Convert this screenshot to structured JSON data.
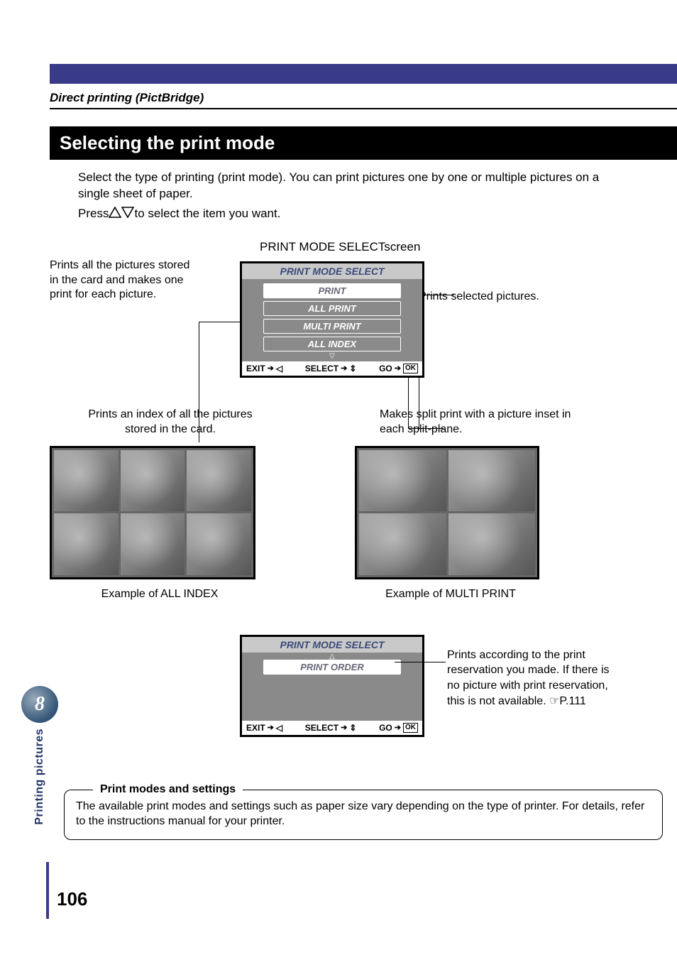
{
  "breadcrumb": "Direct printing (PictBridge)",
  "heading": "Selecting the print mode",
  "intro": "Select the type of printing (print mode). You can print pictures one by one or multiple pictures on a single sheet of paper.",
  "press_prefix": "Press ",
  "press_suffix": " to select the item you want.",
  "screen_title": "PRINT MODE SELECTscreen",
  "lcd1": {
    "title": "PRINT MODE SELECT",
    "items": [
      "PRINT",
      "ALL PRINT",
      "MULTI PRINT",
      "ALL INDEX"
    ],
    "footer": {
      "exit": "EXIT",
      "select": "SELECT",
      "go": "GO",
      "ok": "OK"
    }
  },
  "callouts": {
    "all_print": "Prints all the pictures stored in the card and makes one print for each picture.",
    "print": "Prints selected pictures.",
    "all_index": "Prints an index of all the pictures stored in the card.",
    "multi_print": "Makes split print with a picture inset in each split-plane."
  },
  "caption_left": "Example of ALL INDEX",
  "caption_right": "Example of MULTI PRINT",
  "lcd2": {
    "title": "PRINT MODE SELECT",
    "item": "PRINT ORDER",
    "footer": {
      "exit": "EXIT",
      "select": "SELECT",
      "go": "GO",
      "ok": "OK"
    }
  },
  "print_order_callout": "Prints according to the print reservation you made. If there is no picture with print reservation, this is not available. ",
  "print_order_ref": "P.111",
  "note": {
    "title": "Print modes and settings",
    "body": "The available print modes and settings such as paper size vary depending on the type of printer. For details, refer to the instructions manual for your printer."
  },
  "tab": {
    "number": "8",
    "label": "Printing pictures"
  },
  "page_number": "106"
}
